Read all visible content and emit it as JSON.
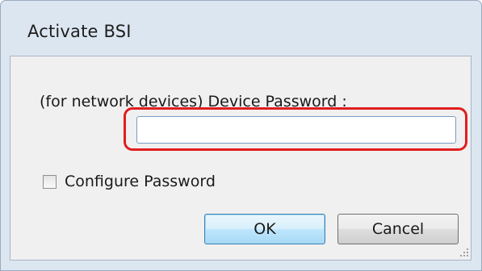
{
  "window": {
    "title": "Activate BSI"
  },
  "form": {
    "password_label": "(for network devices) Device Password :",
    "password_value": "",
    "configure_password_label": "Configure Password",
    "configure_password_checked": false
  },
  "buttons": {
    "ok_label": "OK",
    "cancel_label": "Cancel"
  },
  "colors": {
    "highlight": "#e01e1e",
    "window_frame": "#dce6f1",
    "client_bg": "#f0f0f0"
  }
}
